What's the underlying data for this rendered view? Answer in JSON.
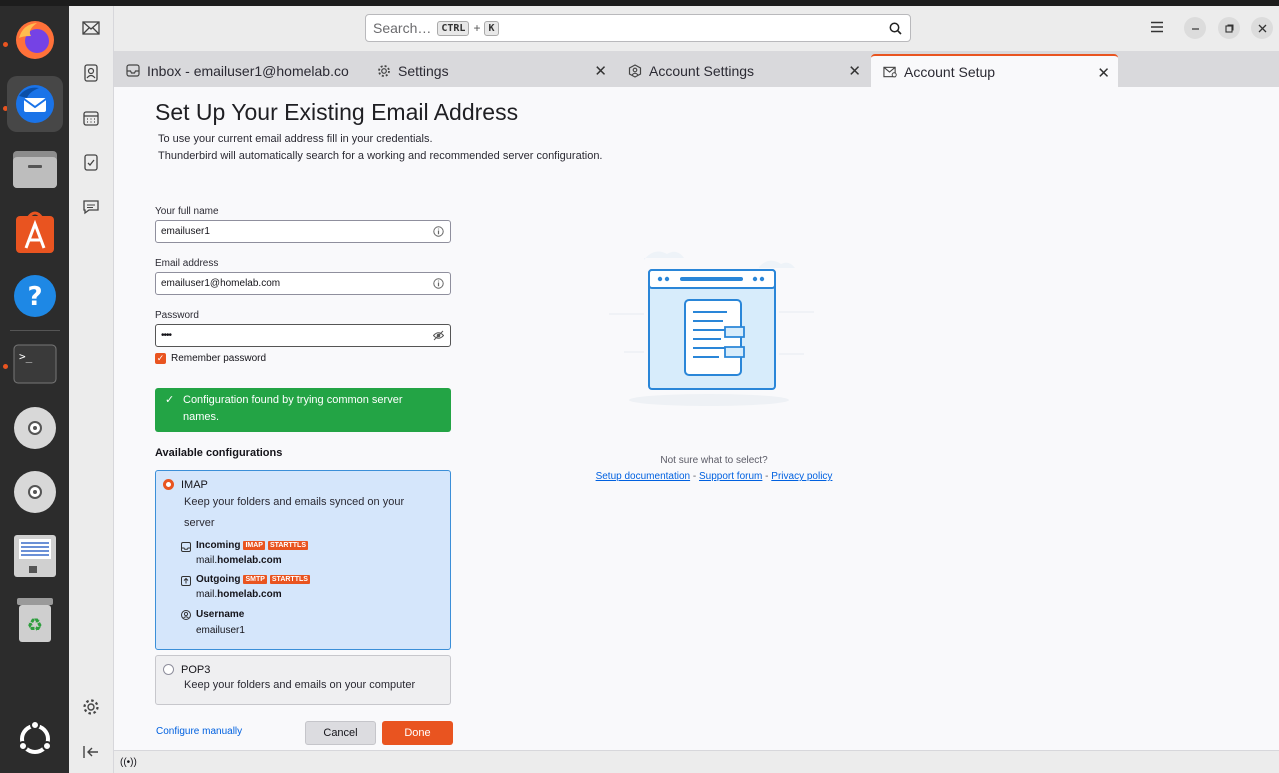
{
  "search": {
    "placeholder": "Search…",
    "key1": "CTRL",
    "plus": "+",
    "key2": "K"
  },
  "tabs": [
    {
      "label": "Inbox - emailuser1@homelab.co"
    },
    {
      "label": "Settings"
    },
    {
      "label": "Account Settings"
    },
    {
      "label": "Account Setup"
    }
  ],
  "page": {
    "title": "Set Up Your Existing Email Address",
    "intro1": "To use your current email address fill in your credentials.",
    "intro2": "Thunderbird will automatically search for a working and recommended server configuration."
  },
  "form": {
    "fullname_label": "Your full name",
    "fullname_value": "emailuser1",
    "email_label": "Email address",
    "email_value": "emailuser1@homelab.com",
    "password_label": "Password",
    "password_value": "••••",
    "remember_label": "Remember password",
    "remember_checked": true
  },
  "found": {
    "check": "✓",
    "message": "Configuration found by trying common server names."
  },
  "configs": {
    "heading": "Available configurations",
    "imap": {
      "title": "IMAP",
      "desc": "Keep your folders and emails synced on your server",
      "incoming_label": "Incoming",
      "incoming_badges": [
        "IMAP",
        "STARTTLS"
      ],
      "incoming_host_prefix": "mail.",
      "incoming_host_domain": "homelab.com",
      "outgoing_label": "Outgoing",
      "outgoing_badges": [
        "SMTP",
        "STARTTLS"
      ],
      "outgoing_host_prefix": "mail.",
      "outgoing_host_domain": "homelab.com",
      "username_label": "Username",
      "username_value": "emailuser1"
    },
    "pop3": {
      "title": "POP3",
      "desc": "Keep your folders and emails on your computer"
    }
  },
  "actions": {
    "configure_manually": "Configure manually",
    "cancel": "Cancel",
    "done": "Done"
  },
  "help": {
    "question": "Not sure what to select?",
    "link1": "Setup documentation",
    "sep": "-",
    "link2": "Support forum",
    "link3": "Privacy policy"
  },
  "status": {
    "icon": "((•))"
  },
  "colors": {
    "accent": "#e95420",
    "success": "#23a445",
    "selected_config": "#d5e6fb",
    "link": "#0061e0"
  }
}
